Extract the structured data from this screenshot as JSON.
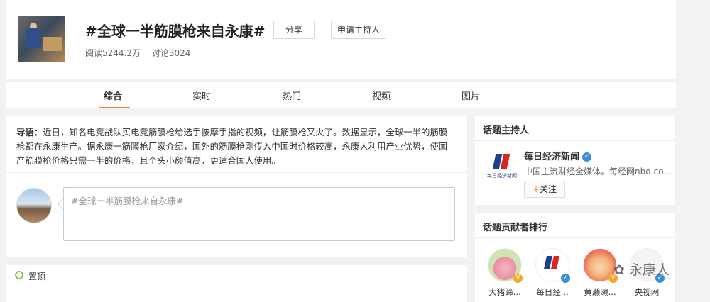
{
  "header": {
    "title": "#全球一半筋膜枪来自永康#",
    "share_label": "分享",
    "host_apply_label": "申请主持人",
    "reads": "阅读5244.2万",
    "discussions": "讨论3024"
  },
  "tabs": [
    {
      "label": "综合"
    },
    {
      "label": "实时"
    },
    {
      "label": "热门"
    },
    {
      "label": "视频"
    },
    {
      "label": "图片"
    }
  ],
  "lead": {
    "prefix": "导语：",
    "text": "近日，知名电竞战队买电竞筋膜枪给选手按摩手指的视频，让筋膜枪又火了。数据显示，全球一半的筋膜枪都在永康生产。据永康一筋膜枪厂家介绍，国外的筋膜枪刚传入中国时价格较高，永康人利用产业优势，使国产筋膜枪价格只需一半的价格，且个头小颜值高，更适合国人使用。"
  },
  "composer": {
    "placeholder": "#全球一半筋膜枪来自永康#"
  },
  "pinned": {
    "label": "置顶"
  },
  "host_section": {
    "title": "话题主持人",
    "name": "每日经济新闻",
    "desc": "中国主流财经全媒体。每经网nbd.co...",
    "follow_plus": "+",
    "follow_label": "关注",
    "logo_text": "每日经济新闻"
  },
  "contrib_section": {
    "title": "话题贡献者排行",
    "items": [
      {
        "name": "大猪蹄...",
        "badge_color": "#f5a623"
      },
      {
        "name": "每日经...",
        "badge_color": "#3c8fd6"
      },
      {
        "name": "黄濑濑...",
        "badge_color": "#f5a623"
      },
      {
        "name": "央视网",
        "badge_color": "#3c8fd6"
      }
    ]
  },
  "watermark": "永康人",
  "colors": {
    "accent": "#fa7d3c",
    "verified_blue": "#3c8fd6",
    "verified_gold": "#f5a623"
  }
}
